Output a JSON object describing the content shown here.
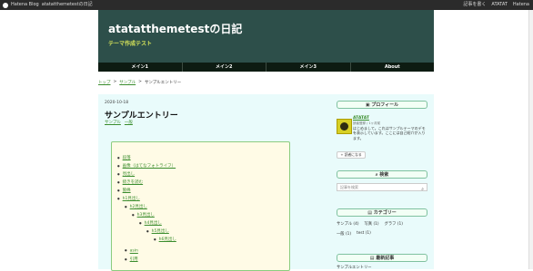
{
  "topbar": {
    "brand": "Hatena Blog",
    "blog_name": "atatatthemetestの日記",
    "post_label": "記事を書く",
    "user_name": "ATATAT",
    "help": "Hatena"
  },
  "header": {
    "title": "atatatthemetestの日記",
    "subtitle": "テーマ作成テスト",
    "colors": {
      "header_bg": "#2d4f4a",
      "accent": "#d8e65a",
      "link": "#3a8d2d"
    }
  },
  "nav": {
    "items": [
      "メイン1",
      "メイン2",
      "メイン3",
      "About"
    ]
  },
  "breadcrumbs": {
    "home": "トップ",
    "sep1": ">",
    "category": "サンプル",
    "sep2": ">",
    "current": "サンプルエントリー"
  },
  "entry": {
    "date": "2020-10-18",
    "title": "サンプルエントリー",
    "categories": [
      "サンプル",
      "一般"
    ],
    "toc": [
      "段落",
      "画像（はてなフォトライフ）",
      "見出し",
      "続きを読む",
      "箇條",
      "h1見出し",
      "h2見出し",
      "h3見出し",
      "h4見出し",
      "h5見出し",
      "h6見出し",
      "asin",
      "引用"
    ]
  },
  "sidebar": {
    "profile_title": "プロフィール",
    "profile_name": "ATATAT",
    "profile_meta": "読者登録 / 1ヶ月前",
    "profile_text": "はじめまして。これはサンプルテーマのデモを表示しています。ここには自己紹介が入ります。",
    "reader_button": "読者になる",
    "search_title": "検索",
    "search_placeholder": "記事を検索",
    "category_title": "カテゴリー",
    "categories": [
      [
        "サンプル (4)",
        "写真 (1)",
        "グラフ (1)"
      ],
      [
        "一般 (1)",
        "test (1)"
      ]
    ],
    "recent_title": "最新記事",
    "recent_first": "サンプルエントリー"
  }
}
